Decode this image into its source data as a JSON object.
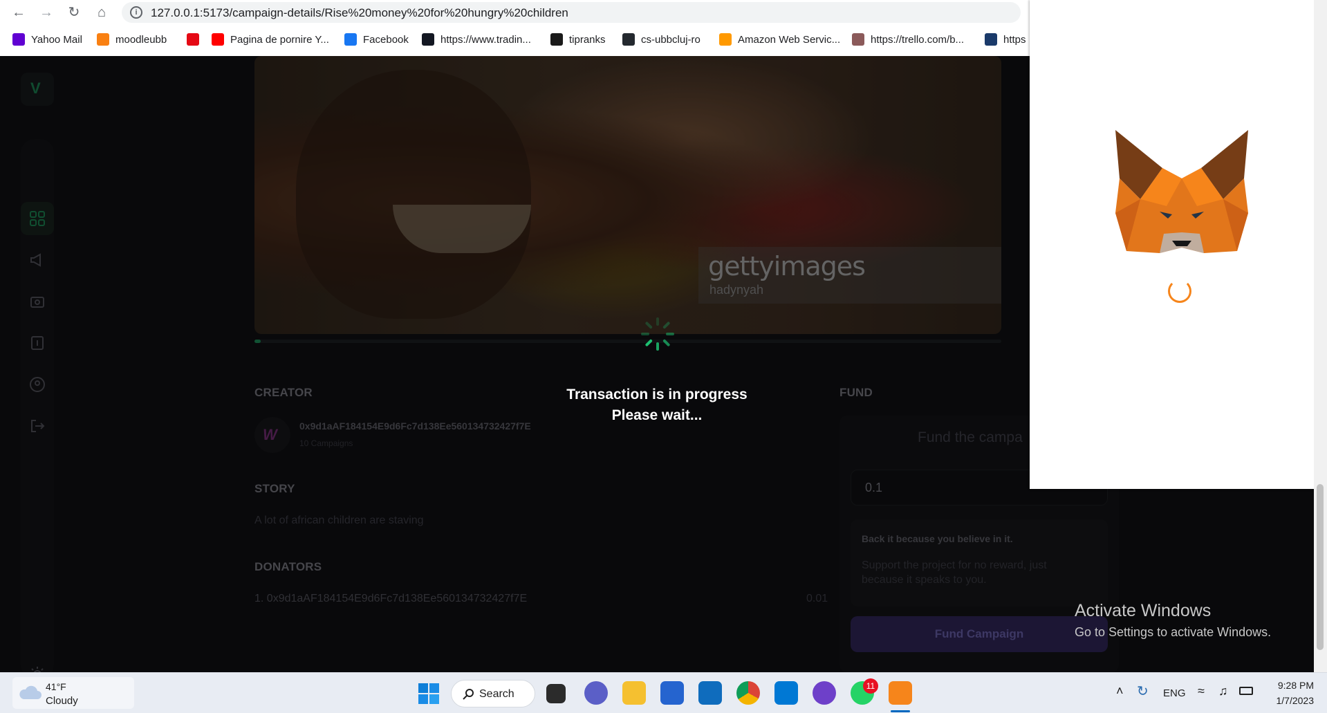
{
  "browser": {
    "url": "127.0.0.1:5173/campaign-details/Rise%20money%20for%20hungry%20children",
    "bookmarks": [
      {
        "label": "Yahoo Mail",
        "icon": "yahoo-mail-icon",
        "color": "#6001d2"
      },
      {
        "label": "moodleubb",
        "icon": "moodle-icon",
        "color": "#f98012"
      },
      {
        "label": "",
        "icon": "netflix-icon",
        "color": "#e50914"
      },
      {
        "label": "Pagina de pornire Y...",
        "icon": "youtube-icon",
        "color": "#ff0000"
      },
      {
        "label": "Facebook",
        "icon": "facebook-icon",
        "color": "#1877f2"
      },
      {
        "label": "https://www.tradin...",
        "icon": "tradingview-icon",
        "color": "#131722"
      },
      {
        "label": "tipranks",
        "icon": "tipranks-icon",
        "color": "#1a1a1a"
      },
      {
        "label": "cs-ubbcluj-ro",
        "icon": "github-icon",
        "color": "#24292f"
      },
      {
        "label": "Amazon Web Servic...",
        "icon": "aws-icon",
        "color": "#ff9900"
      },
      {
        "label": "https://trello.com/b...",
        "icon": "trello-icon",
        "color": "#8b5a5a"
      },
      {
        "label": "https",
        "icon": "fl-icon",
        "color": "#1a3a6a"
      }
    ]
  },
  "app": {
    "logo_letter": "V",
    "watermark": "gettyimages",
    "watermark_sub": "hadynyah",
    "progress_fraction": 0.008,
    "creator_heading": "CREATOR",
    "creator_address": "0x9d1aAF184154E9d6Fc7d138Ee560134732427f7E",
    "creator_campaigns": "10 Campaigns",
    "story_heading": "STORY",
    "story_text": "A lot of african children are staving",
    "donators_heading": "DONATORS",
    "donators": [
      {
        "entry": "1. 0x9d1aAF184154E9d6Fc7d138Ee560134732427f7E",
        "amount": "0.01"
      }
    ],
    "fund_heading": "FUND",
    "fund_title": "Fund the campa",
    "fund_amount": "0.1",
    "note_heading": "Back it because you believe in it.",
    "note_body": "Support the project for no reward, just because it speaks to you.",
    "fund_button": "Fund Campaign",
    "loader_line1": "Transaction is in progress",
    "loader_line2": "Please wait..."
  },
  "windows_activation": {
    "title": "Activate Windows",
    "body": "Go to Settings to activate Windows."
  },
  "taskbar": {
    "temp": "41°F",
    "weather": "Cloudy",
    "search": "Search",
    "lang": "ENG",
    "time": "9:28 PM",
    "date": "1/7/2023",
    "whatsapp_badge": "11"
  }
}
